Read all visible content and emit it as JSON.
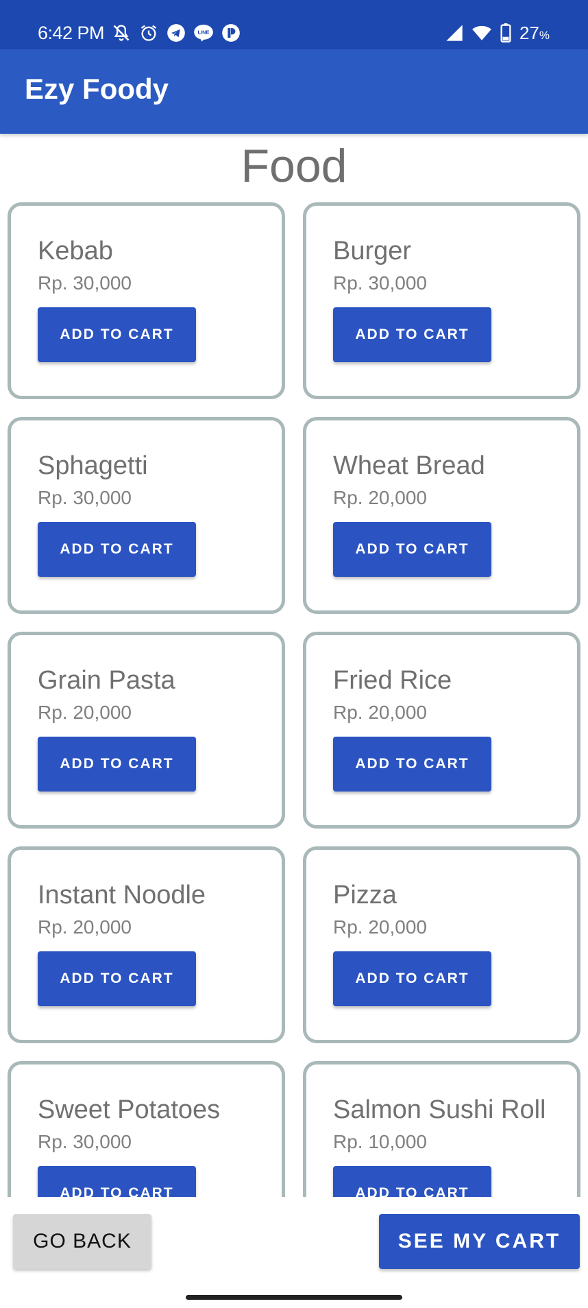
{
  "status_bar": {
    "time": "6:42 PM",
    "icons_left": [
      "mute-bell-icon",
      "alarm-icon",
      "telegram-icon",
      "line-icon",
      "p-app-icon"
    ],
    "icons_right": [
      "signal-icon",
      "wifi-icon",
      "battery-icon"
    ],
    "battery_percent": "27",
    "battery_unit": "%",
    "line_label": "LINE"
  },
  "app_bar": {
    "title": "Ezy Foody"
  },
  "page": {
    "title": "Food"
  },
  "items": [
    {
      "name": "Kebab",
      "price": "Rp. 30,000",
      "button": "ADD TO CART"
    },
    {
      "name": "Burger",
      "price": "Rp. 30,000",
      "button": "ADD TO CART"
    },
    {
      "name": "Sphagetti",
      "price": "Rp. 30,000",
      "button": "ADD TO CART"
    },
    {
      "name": "Wheat Bread",
      "price": "Rp. 20,000",
      "button": "ADD TO CART"
    },
    {
      "name": "Grain Pasta",
      "price": "Rp. 20,000",
      "button": "ADD TO CART"
    },
    {
      "name": "Fried Rice",
      "price": "Rp. 20,000",
      "button": "ADD TO CART"
    },
    {
      "name": "Instant Noodle",
      "price": "Rp. 20,000",
      "button": "ADD TO CART"
    },
    {
      "name": "Pizza",
      "price": "Rp. 20,000",
      "button": "ADD TO CART"
    },
    {
      "name": "Sweet Potatoes",
      "price": "Rp. 30,000",
      "button": "ADD TO CART"
    },
    {
      "name": "Salmon Sushi Roll",
      "price": "Rp. 10,000",
      "button": "ADD TO CART"
    }
  ],
  "bottom": {
    "back_label": "GO BACK",
    "cart_label": "SEE MY CART"
  },
  "colors": {
    "status_bar": "#1d48b0",
    "app_bar": "#2b5bc2",
    "primary_button": "#2b54c2",
    "card_border": "#a9b8b9",
    "secondary_button": "#d6d6d6"
  }
}
